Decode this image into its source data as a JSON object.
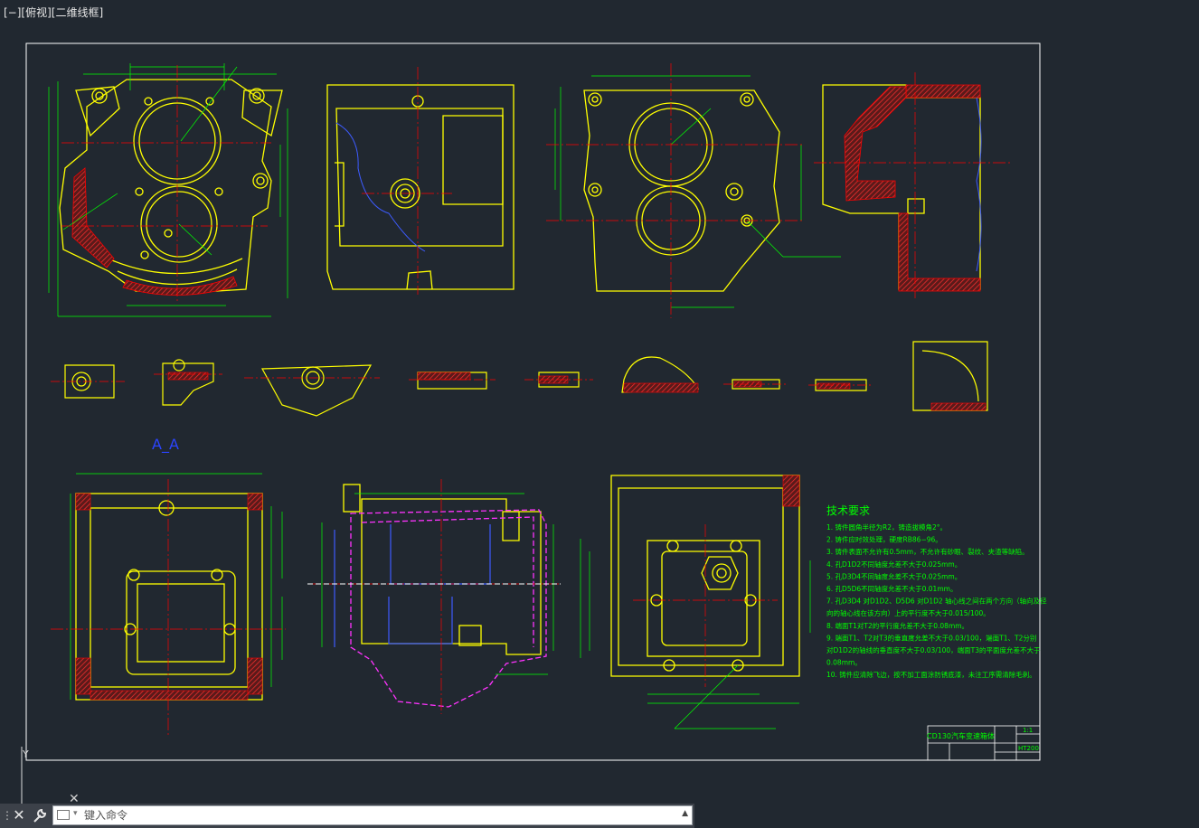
{
  "viewport": {
    "label": "[−][俯视][二维线框]"
  },
  "section_label": "A_A",
  "tech_requirements": {
    "title": "技术要求",
    "items": [
      "1. 铸件圆角半径为R2，铸造拔模角2°。",
      "2. 铸件应时效处理，硬度RB86−96。",
      "3. 铸件表面不允许有0.5mm，不允许有砂眼、裂纹、夹渣等缺陷。",
      "4. 孔D1D2不同轴度允差不大于0.025mm。",
      "5. 孔D3D4不同轴度允差不大于0.025mm。",
      "6. 孔D5D6不同轴度允差不大于0.01mm。",
      "7. 孔D3D4 对D1D2、D5D6 对D1D2 轴心线之间在两个方向（轴向及径",
      "向的轴心线在该方向）上的平行度不大于0.015/100。",
      "8. 端面T1对T2的平行度允差不大于0.08mm。",
      "9. 端面T1、T2对T3的垂直度允差不大于0.03/100，端面T1、T2分别",
      "对D1D2的轴线的垂直度不大于0.03/100，端面T3的平面度允差不大于",
      "0.08mm。",
      "10. 铸件应清除飞边，按不加工面涂防锈底漆，未注工序需清除毛刺。"
    ]
  },
  "title_block": {
    "name": "CD130汽车变速箱体",
    "scale": "1:1",
    "material": "HT200"
  },
  "command_line": {
    "placeholder": "键入命令",
    "close_glyph": "✕",
    "history_glyph": "▲"
  },
  "colors": {
    "background": "#212830",
    "frame": "#ffffff",
    "outline": "#ffff00",
    "dimension": "#00ff00",
    "center": "#ff0000",
    "hatch": "#ff0000",
    "hidden": "#ff00ff",
    "section_label": "#0000ff",
    "note_text": "#00ff00"
  }
}
